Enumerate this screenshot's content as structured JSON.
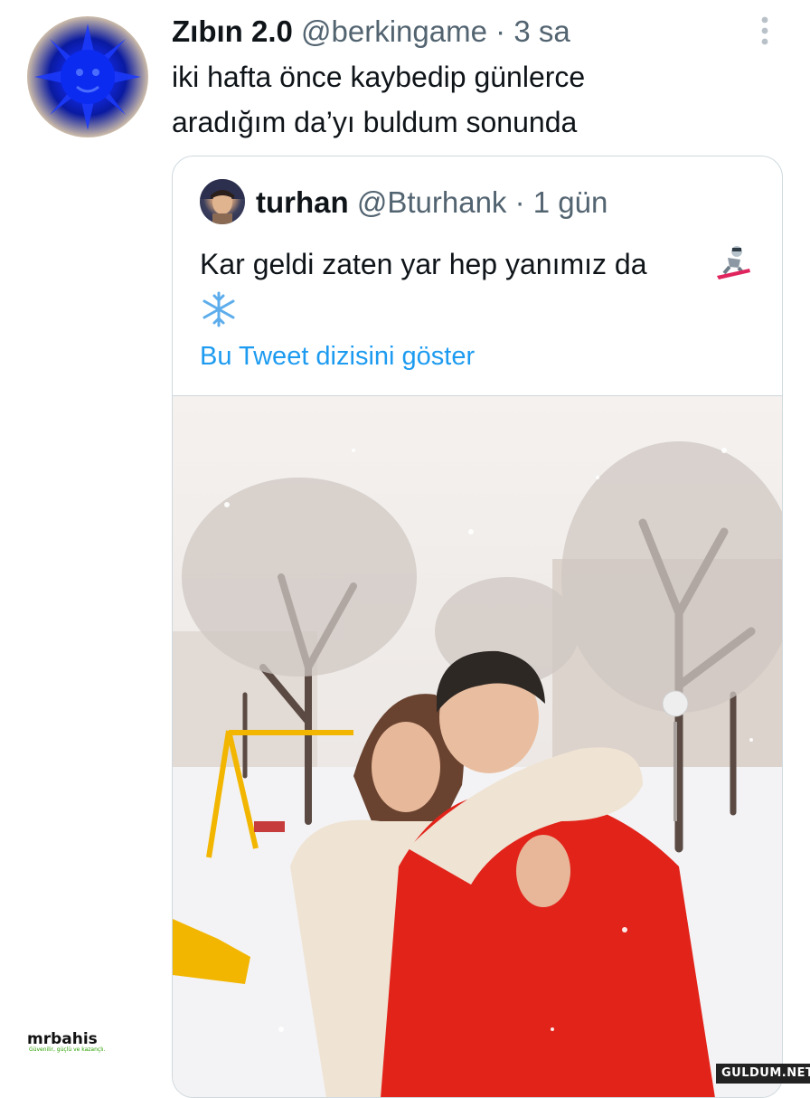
{
  "tweet": {
    "author_name": "Zıbın 2.0",
    "author_handle": "@berkingame",
    "separator": "·",
    "time": "3 sa",
    "text": "iki hafta önce kaybedip günlerce\naradığım da’yı buldum sonunda",
    "more_icon": "more-vertical-icon"
  },
  "quoted": {
    "author_name": "turhan",
    "author_handle": "@Bturhank",
    "separator": "·",
    "time": "1 gün",
    "text": "Kar geldi zaten yar hep yanımız da",
    "emojis": [
      "snowboarder-icon",
      "snowflake-icon"
    ],
    "show_thread_label": "Bu Tweet dizisini göster",
    "link_color": "#1d9bf0"
  },
  "watermarks": {
    "left_brand": "mrbahis",
    "left_tagline": "Güvenilir, güçlü ve kazançlı.",
    "right": "GULDUM.NET"
  }
}
